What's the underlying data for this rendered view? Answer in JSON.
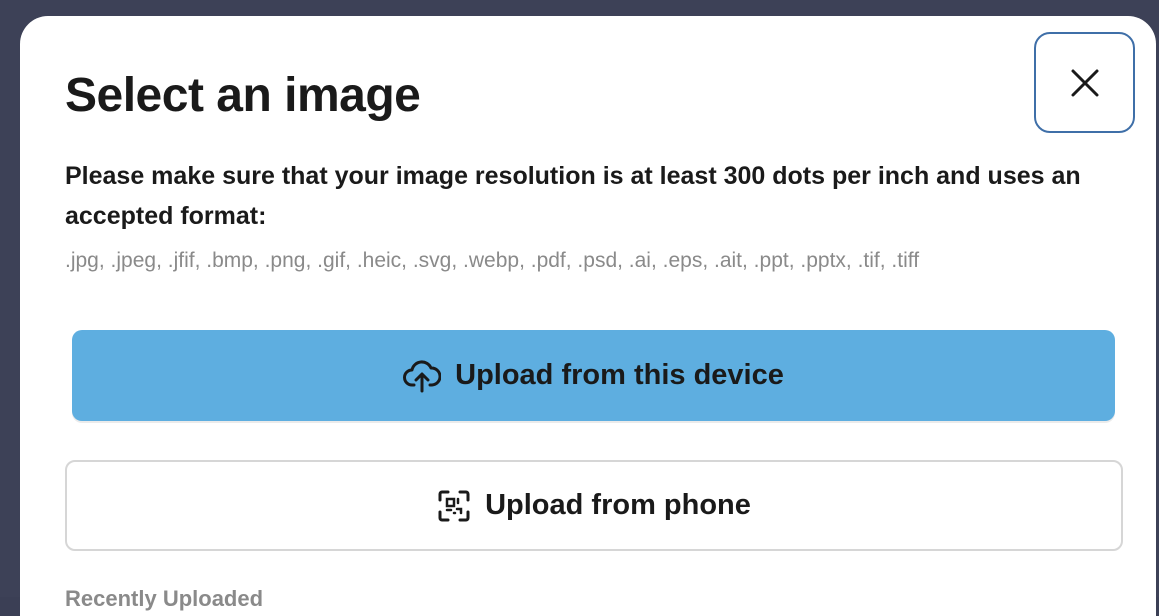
{
  "modal": {
    "title": "Select an image",
    "instructions": "Please make sure that your image resolution is at least 300 dots per inch and uses an accepted format:",
    "formats": ".jpg, .jpeg, .jfif, .bmp, .png, .gif, .heic, .svg, .webp, .pdf, .psd, .ai, .eps, .ait, .ppt, .pptx, .tif, .tiff",
    "close_icon": "close-icon",
    "upload_device": {
      "label": "Upload from this device",
      "icon": "cloud-upload-icon",
      "color": "#5eaee0"
    },
    "upload_phone": {
      "label": "Upload from phone",
      "icon": "qr-scan-icon"
    },
    "recent_heading": "Recently Uploaded"
  },
  "colors": {
    "accent_button": "#5eaee0",
    "focus_ring": "#3f6fa8",
    "backdrop": "#3d4157",
    "muted_text": "#8a8a8a"
  }
}
